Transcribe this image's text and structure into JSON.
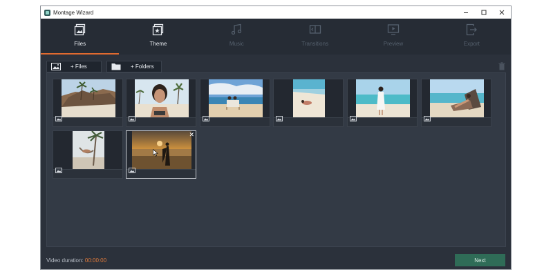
{
  "window": {
    "title": "Montage Wizard"
  },
  "steps": [
    {
      "label": "Files",
      "icon": "files-icon",
      "state": "active"
    },
    {
      "label": "Theme",
      "icon": "theme-icon",
      "state": "enabled"
    },
    {
      "label": "Music",
      "icon": "music-icon",
      "state": "disabled"
    },
    {
      "label": "Transitions",
      "icon": "transitions-icon",
      "state": "disabled"
    },
    {
      "label": "Preview",
      "icon": "preview-icon",
      "state": "disabled"
    },
    {
      "label": "Export",
      "icon": "export-icon",
      "state": "disabled"
    }
  ],
  "toolbar": {
    "add_files_label": "+ Files",
    "add_folders_label": "+ Folders"
  },
  "media": [
    {
      "type": "image",
      "scene": "island with palms and sand"
    },
    {
      "type": "image",
      "scene": "woman portrait with palm trees"
    },
    {
      "type": "image",
      "scene": "couple sitting on beach"
    },
    {
      "type": "image",
      "scene": "person lying on white sand"
    },
    {
      "type": "image",
      "scene": "woman in white dress on beach"
    },
    {
      "type": "image",
      "scene": "man on sun lounger by the sea"
    },
    {
      "type": "image",
      "scene": "palm tree with hammock"
    },
    {
      "type": "image",
      "scene": "couple at sunset",
      "selected": true
    }
  ],
  "footer": {
    "duration_label": "Video duration:",
    "duration_value": "00:00:00",
    "next_label": "Next"
  },
  "colors": {
    "accent": "#e06a2f",
    "next": "#2f6c57",
    "duration": "#e07a3a"
  }
}
